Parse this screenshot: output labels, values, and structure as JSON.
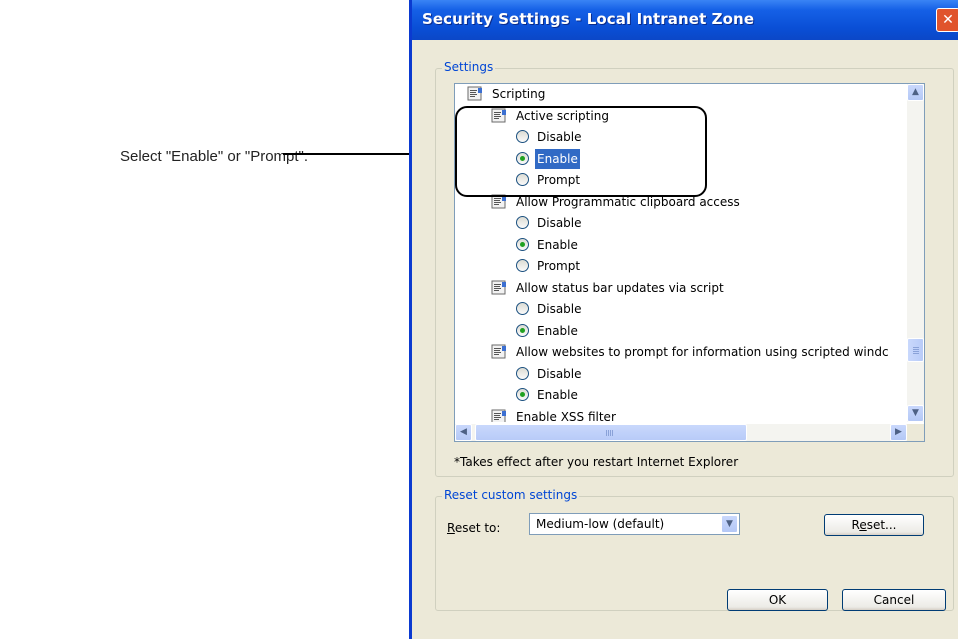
{
  "annotation": {
    "text": "Select \"Enable\" or \"Prompt\"."
  },
  "window": {
    "title": "Security Settings - Local Intranet Zone",
    "close_symbol": "✕"
  },
  "settings": {
    "group_label": "Settings",
    "items": [
      {
        "type": "category",
        "label": "Scripting",
        "icon": "settings-page-icon"
      },
      {
        "type": "setting",
        "label": "Active scripting",
        "icon": "settings-page-icon"
      },
      {
        "type": "option",
        "label": "Disable",
        "checked": false
      },
      {
        "type": "option",
        "label": "Enable",
        "checked": true,
        "selected": true
      },
      {
        "type": "option",
        "label": "Prompt",
        "checked": false
      },
      {
        "type": "setting",
        "label": "Allow Programmatic clipboard access",
        "icon": "settings-page-icon"
      },
      {
        "type": "option",
        "label": "Disable",
        "checked": false
      },
      {
        "type": "option",
        "label": "Enable",
        "checked": true
      },
      {
        "type": "option",
        "label": "Prompt",
        "checked": false
      },
      {
        "type": "setting",
        "label": "Allow status bar updates via script",
        "icon": "settings-page-icon"
      },
      {
        "type": "option",
        "label": "Disable",
        "checked": false
      },
      {
        "type": "option",
        "label": "Enable",
        "checked": true
      },
      {
        "type": "setting",
        "label": "Allow websites to prompt for information using scripted windc",
        "icon": "settings-page-icon"
      },
      {
        "type": "option",
        "label": "Disable",
        "checked": false
      },
      {
        "type": "option",
        "label": "Enable",
        "checked": true
      },
      {
        "type": "setting",
        "label": "Enable XSS filter",
        "icon": "settings-page-icon"
      }
    ],
    "note": "*Takes effect after you restart Internet Explorer"
  },
  "reset": {
    "group_label": "Reset custom settings",
    "label_underlined": "R",
    "label_rest": "eset to:",
    "select_value": "Medium-low (default)",
    "button_before": "R",
    "button_underlined": "e",
    "button_after": "set..."
  },
  "footer": {
    "ok_label": "OK",
    "cancel_label": "Cancel"
  },
  "colors": {
    "title_bar": "#0a4fd6",
    "selection": "#316ac5",
    "dialog_bg": "#ece9d8",
    "group_label": "#0046d5",
    "radio_dot": "#21a121"
  }
}
